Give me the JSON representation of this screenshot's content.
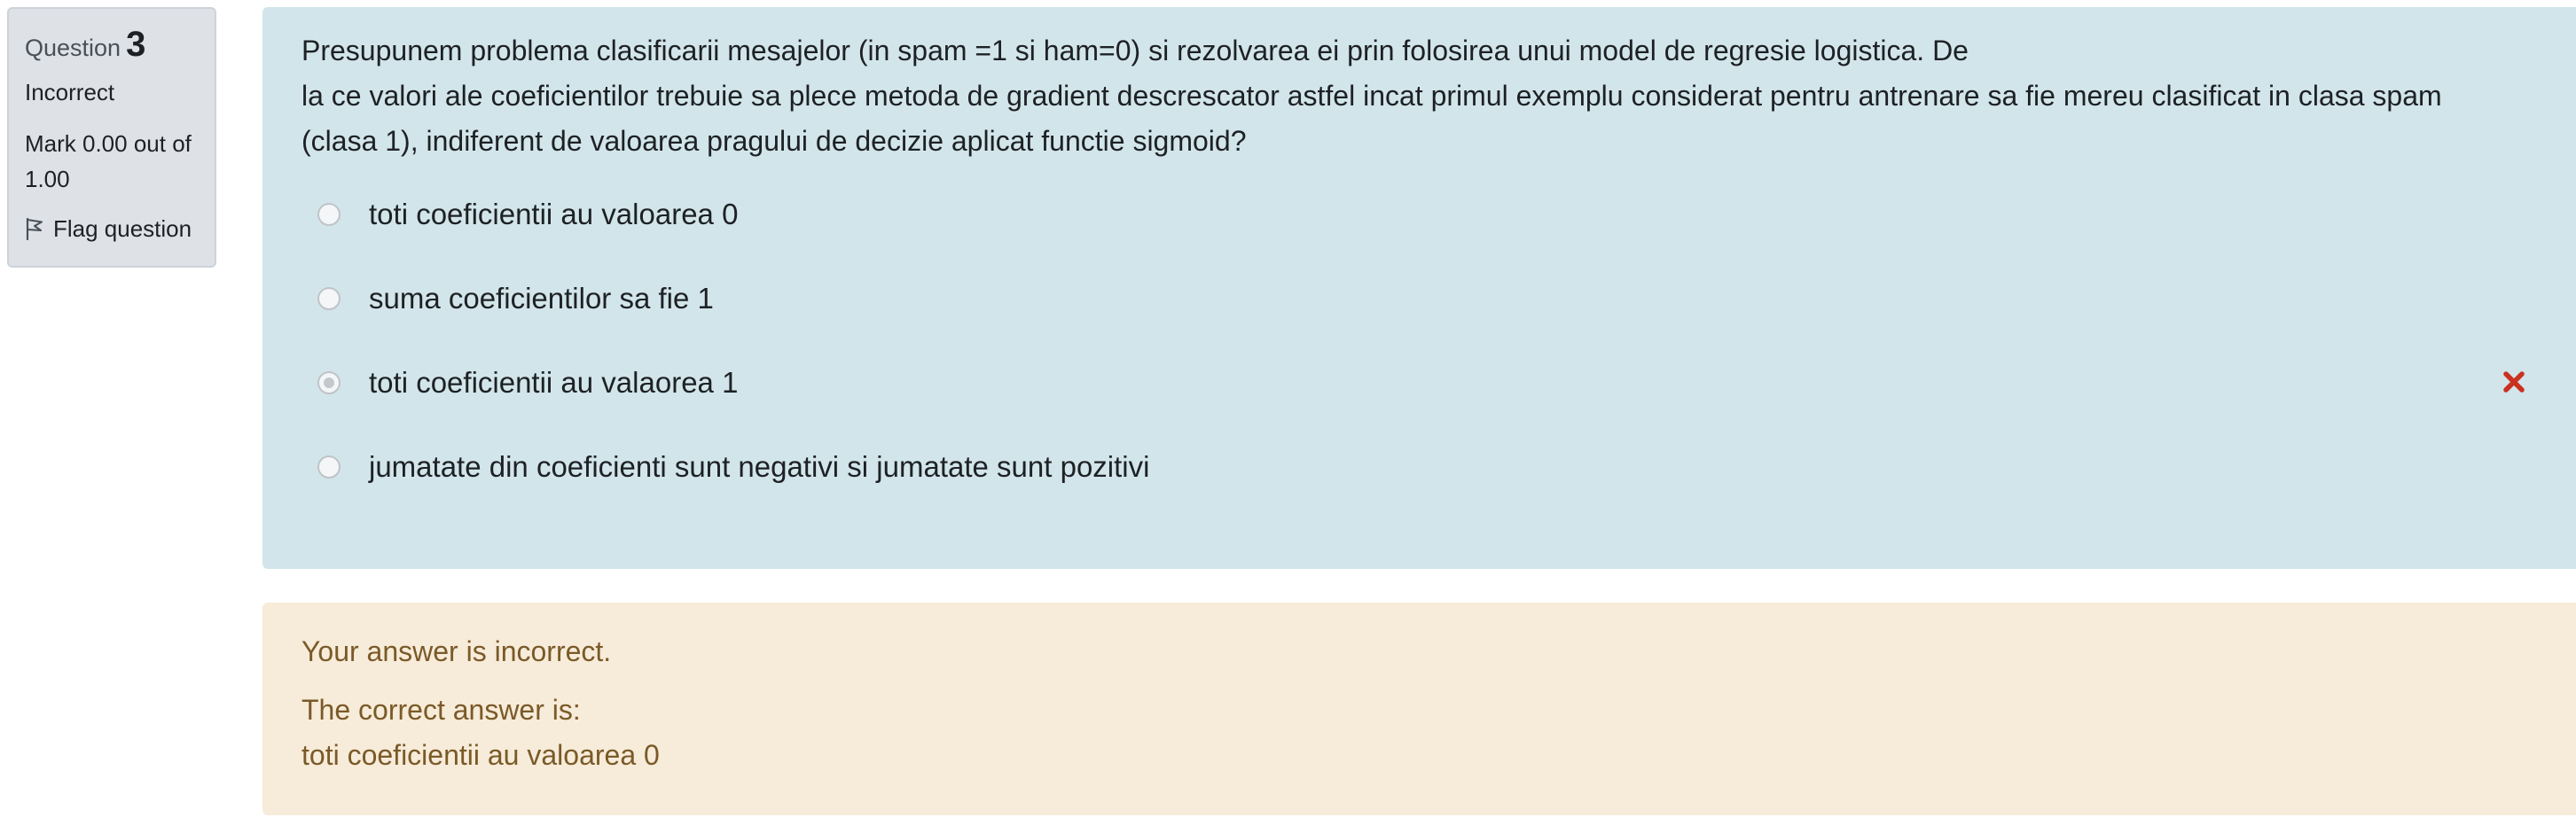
{
  "info": {
    "question_label": "Question",
    "question_number": "3",
    "state": "Incorrect",
    "grade": "Mark 0.00 out of 1.00",
    "flag_label": "Flag question"
  },
  "question": {
    "text_lines": [
      "Presupunem problema clasificarii mesajelor (in spam =1 si ham=0) si rezolvarea ei prin folosirea unui model de regresie logistica. De",
      "la ce valori ale coeficientilor trebuie sa plece metoda de gradient descrescator astfel incat primul exemplu considerat pentru antrenare sa fie mereu clasificat in clasa spam",
      "(clasa 1), indiferent de valoarea pragului de decizie aplicat functie sigmoid?"
    ],
    "answers": [
      {
        "label": "toti coeficientii au valoarea 0",
        "selected": false,
        "marked_incorrect": false
      },
      {
        "label": "suma coeficientilor sa fie 1",
        "selected": false,
        "marked_incorrect": false
      },
      {
        "label": "toti coeficientii au valaorea 1",
        "selected": true,
        "marked_incorrect": true
      },
      {
        "label": "jumatate din coeficienti sunt negativi si jumatate sunt pozitivi",
        "selected": false,
        "marked_incorrect": false
      }
    ]
  },
  "feedback": {
    "result": "Your answer is incorrect.",
    "correct_answer_heading": "The correct answer is:",
    "correct_answer": "toti coeficientii au valoarea 0"
  },
  "icons": {
    "flag": "flag-icon",
    "incorrect": "incorrect-x-icon"
  },
  "colors": {
    "info_bg": "#dee2e6",
    "question_bg": "#d2e5ea",
    "feedback_bg": "#f7ebd9",
    "feedback_text": "#7a5a28",
    "incorrect_icon": "#ca3120"
  }
}
